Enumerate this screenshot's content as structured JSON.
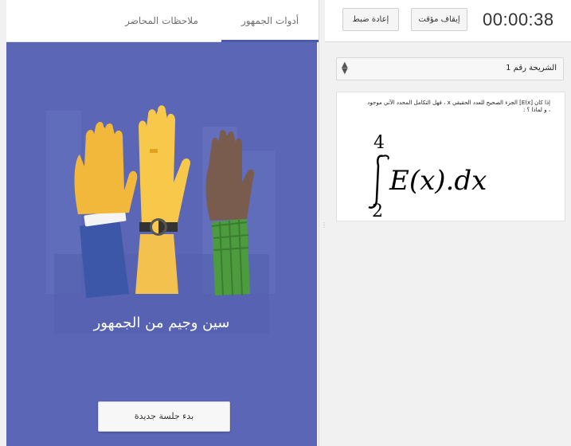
{
  "left_panel": {
    "tabs": [
      {
        "label": "أدوات الجمهور",
        "active": true
      },
      {
        "label": "ملاحظات المحاضر",
        "active": false
      }
    ],
    "empty_state_text": "سين وجيم من الجمهور",
    "new_session_button": "بدء جلسة جديدة"
  },
  "timer": {
    "time": "00:00:38",
    "pause_button": "إيقاف مؤقت",
    "reset_button": "إعادة ضبط"
  },
  "slide_selector": {
    "selected": "الشريحة رقم 1"
  },
  "slide": {
    "text": "إذا كان [E(x] الجزء الصحيح للعدد الحقيقي x ، فهل التكامل المحدد الآتي موجود ، و لماذا ؟ :",
    "formula": {
      "upper_limit": "4",
      "lower_limit": "2",
      "expression": "E(x).dx"
    }
  },
  "colors": {
    "stage_background": "#5b66b6",
    "tab_underline": "#4b5ba8",
    "panel_background": "#f1f1f1"
  }
}
